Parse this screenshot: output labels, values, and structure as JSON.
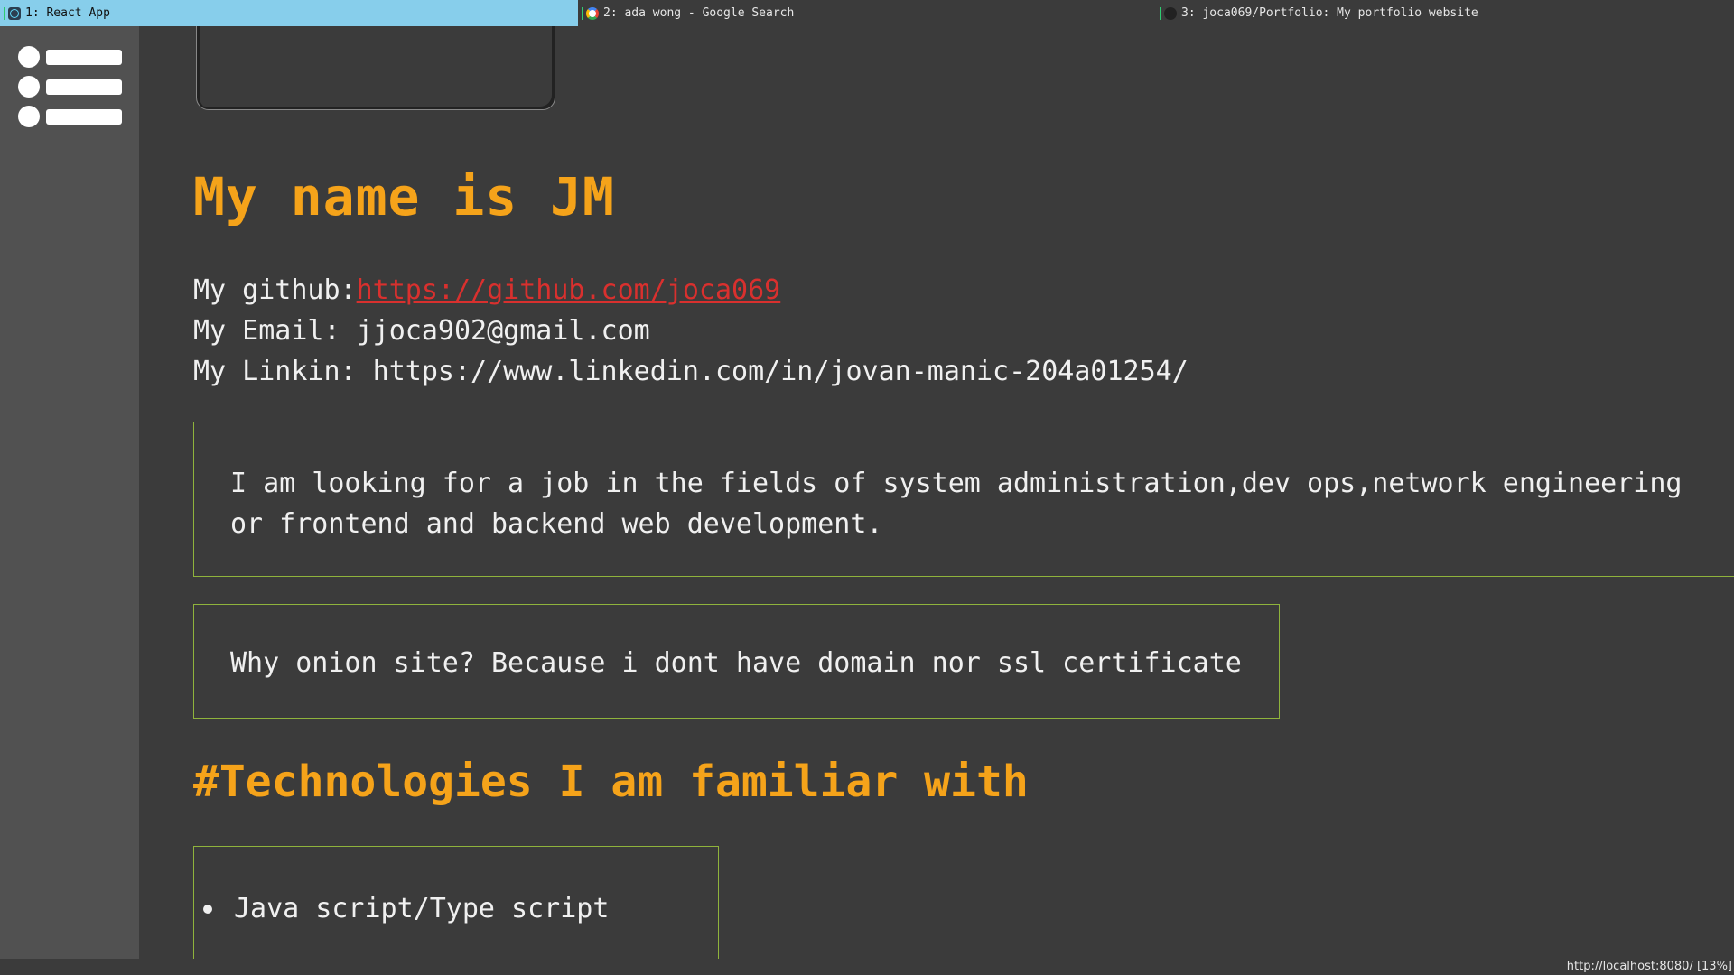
{
  "tabs": [
    {
      "label": "1: React App",
      "icon": "react-icon",
      "active": true
    },
    {
      "label": "2: ada wong - Google Search",
      "icon": "google-icon",
      "active": false
    },
    {
      "label": "3: joca069/Portfolio: My portfolio website",
      "icon": "github-icon",
      "active": false
    }
  ],
  "sidebar": {
    "menu_icon": "hamburger-list-icon"
  },
  "main": {
    "heading": "My name is JM",
    "github_label": "My github:",
    "github_link": "https://github.com/joca069",
    "email_line": "My Email: jjoca902@gmail.com",
    "linkedin_line": "My Linkin: https://www.linkedin.com/in/jovan-manic-204a01254/",
    "job_text": "I am looking for a job in the fields of system administration,dev ops,network engineering or frontend and backend web development.",
    "onion_text": "Why onion site? Because i dont have domain nor ssl certificate",
    "tech_heading": "#Technologies I am familiar with",
    "tech_items": [
      "Java script/Type script"
    ]
  },
  "status": {
    "url": "http://localhost:8080/",
    "scroll": "[13%]"
  },
  "colors": {
    "accent": "#f5a31a",
    "link": "#d9302e",
    "border": "#8fb33c",
    "active_tab": "#87ceeb"
  }
}
